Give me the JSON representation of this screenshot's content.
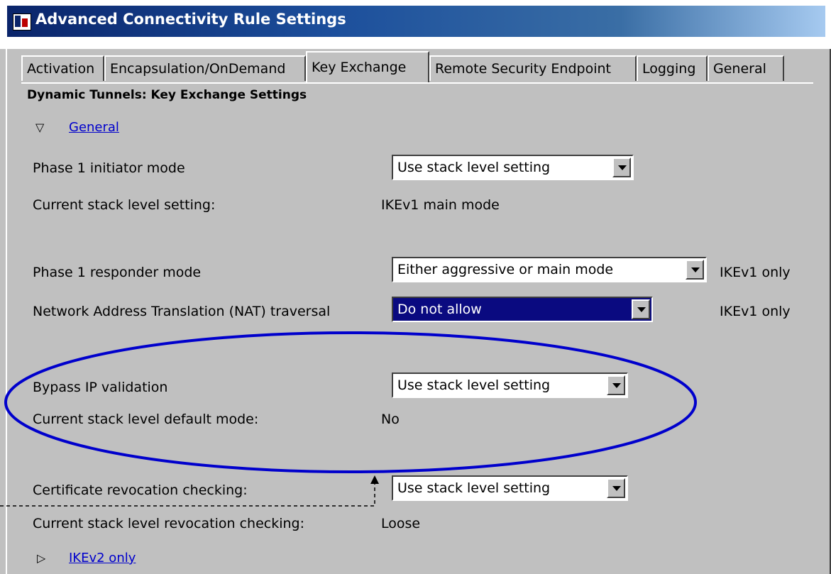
{
  "window": {
    "title": "Advanced Connectivity Rule Settings"
  },
  "tabs": [
    {
      "label": "Activation"
    },
    {
      "label": "Encapsulation/OnDemand"
    },
    {
      "label": "Key Exchange"
    },
    {
      "label": "Remote Security Endpoint"
    },
    {
      "label": "Logging"
    },
    {
      "label": "General"
    }
  ],
  "active_tab": "Key Exchange",
  "section_title": "Dynamic Tunnels: Key Exchange Settings",
  "general_section": {
    "label": "General",
    "expanded": true
  },
  "rows": {
    "phase1_initiator": {
      "label": "Phase 1 initiator mode",
      "value": "Use stack level setting"
    },
    "current_stack": {
      "label": "Current stack level setting:",
      "value": "IKEv1 main mode"
    },
    "phase1_responder": {
      "label": "Phase 1 responder mode",
      "value": "Either aggressive or main mode",
      "note": "IKEv1 only"
    },
    "nat_traversal": {
      "label": "Network Address Translation (NAT) traversal",
      "value": "Do not allow",
      "note": "IKEv1 only"
    },
    "bypass_ip": {
      "label": "Bypass IP validation",
      "value": "Use stack level setting"
    },
    "default_mode": {
      "label": "Current stack level default mode:",
      "value": "No"
    },
    "cert_revocation": {
      "label": "Certificate revocation checking:",
      "value": "Use stack level setting"
    },
    "revocation_current": {
      "label": "Current stack level revocation checking:",
      "value": "Loose"
    }
  },
  "ikev2_section": {
    "label": "IKEv2 only",
    "expanded": false
  },
  "colors": {
    "highlight_ellipse": "#0000cc",
    "selection": "#0a0a80",
    "titlebar": "#0a246a"
  }
}
